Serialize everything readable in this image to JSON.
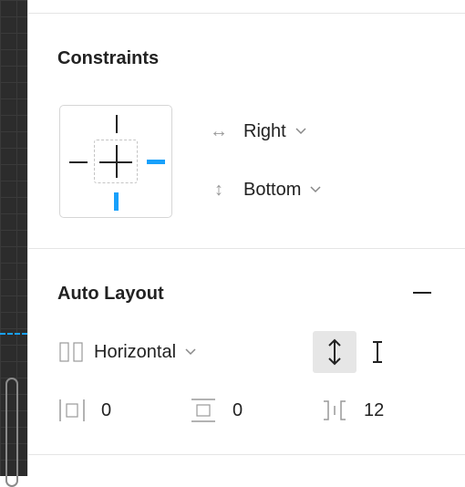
{
  "constraints": {
    "title": "Constraints",
    "horizontal": {
      "icon": "horizontal-arrows-icon",
      "value": "Right"
    },
    "vertical": {
      "icon": "vertical-arrows-icon",
      "value": "Bottom"
    }
  },
  "auto_layout": {
    "title": "Auto Layout",
    "remove_icon": "minus-icon",
    "direction": {
      "icon": "columns-icon",
      "value": "Horizontal"
    },
    "alignment_icon": "vertical-resize-icon",
    "text_cursor_icon": "text-cursor-icon",
    "horizontal_padding": {
      "icon": "horizontal-padding-icon",
      "value": "0"
    },
    "vertical_padding": {
      "icon": "vertical-padding-icon",
      "value": "0"
    },
    "spacing": {
      "icon": "spacing-between-icon",
      "value": "12"
    }
  },
  "colors": {
    "accent": "#18a0fb",
    "border": "#e5e5e5",
    "selected_bg": "#e6e6e6"
  }
}
